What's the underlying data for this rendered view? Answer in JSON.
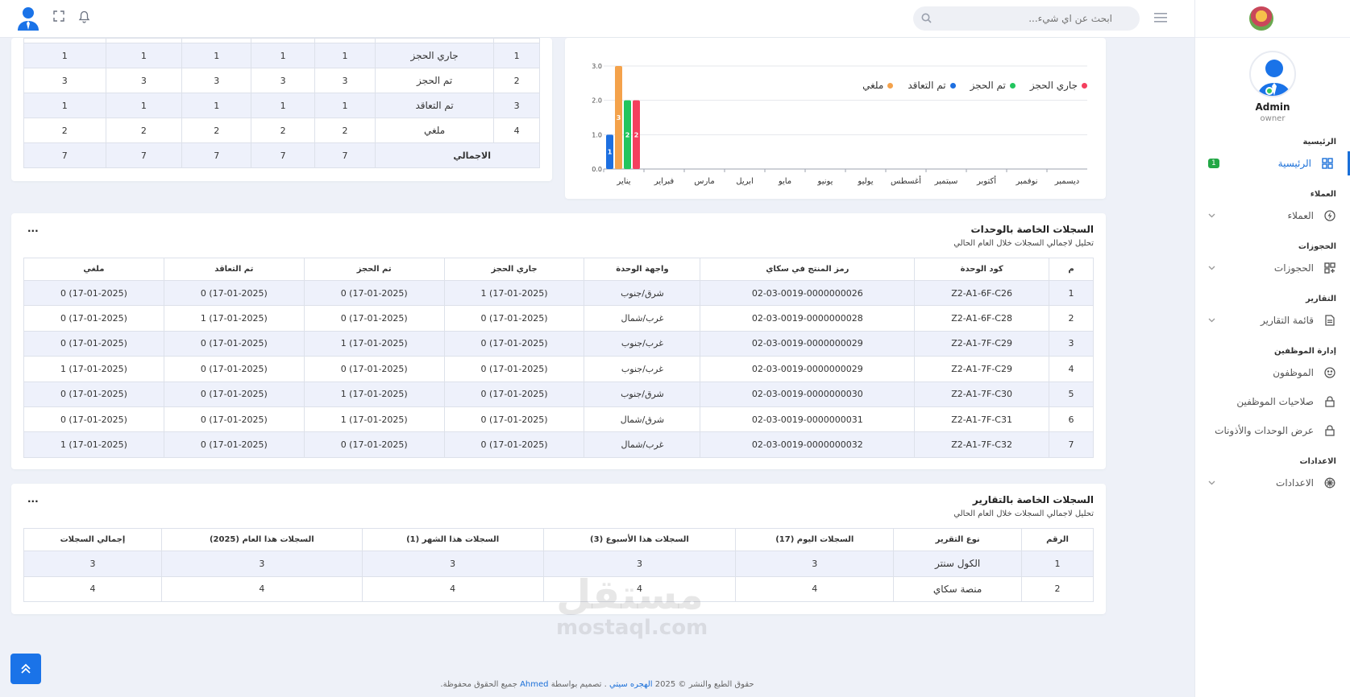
{
  "topbar": {
    "search_placeholder": "ابحث عن اي شيء...",
    "menu_icon": "hamburger-icon",
    "bell_icon": "bell-icon",
    "fullscreen_icon": "fullscreen-icon"
  },
  "sidebar": {
    "profile": {
      "name": "Admin",
      "role": "owner"
    },
    "sections": [
      {
        "title": "الرئيسية",
        "items": [
          {
            "label": "الرئيسية",
            "icon": "grid-icon",
            "badge": "1",
            "active": true
          }
        ]
      },
      {
        "title": "العملاء",
        "items": [
          {
            "label": "العملاء",
            "icon": "bolt-icon",
            "chevron": true
          }
        ]
      },
      {
        "title": "الحجوزات",
        "items": [
          {
            "label": "الحجوزات",
            "icon": "grid-plus-icon",
            "chevron": true
          }
        ]
      },
      {
        "title": "التقارير",
        "items": [
          {
            "label": "قائمة التقارير",
            "icon": "document-icon",
            "chevron": true
          }
        ]
      },
      {
        "title": "إدارة الموظفين",
        "items": [
          {
            "label": "الموظفون",
            "icon": "smile-icon"
          },
          {
            "label": "صلاحيات الموظفين",
            "icon": "lock-icon"
          },
          {
            "label": "عرض الوحدات والأذونات",
            "icon": "lock-icon"
          }
        ]
      },
      {
        "title": "الاعدادات",
        "items": [
          {
            "label": "الاعدادات",
            "icon": "gear-icon",
            "chevron": true
          }
        ]
      }
    ]
  },
  "summary_table": {
    "rows": [
      {
        "num": "1",
        "label": "جاري الحجز",
        "vals": [
          "1",
          "1",
          "1",
          "1",
          "1"
        ]
      },
      {
        "num": "2",
        "label": "تم الحجز",
        "vals": [
          "3",
          "3",
          "3",
          "3",
          "3"
        ]
      },
      {
        "num": "3",
        "label": "تم التعاقد",
        "vals": [
          "1",
          "1",
          "1",
          "1",
          "1"
        ]
      },
      {
        "num": "4",
        "label": "ملغي",
        "vals": [
          "2",
          "2",
          "2",
          "2",
          "2"
        ]
      }
    ],
    "total": {
      "label": "الاجمالي",
      "vals": [
        "7",
        "7",
        "7",
        "7",
        "7"
      ]
    }
  },
  "chart_data": {
    "type": "bar",
    "categories": [
      "يناير",
      "فبراير",
      "مارس",
      "ابريل",
      "مايو",
      "يونيو",
      "يوليو",
      "أغسطس",
      "سبتمبر",
      "أكتوبر",
      "نوفمبر",
      "ديسمبر"
    ],
    "series": [
      {
        "name": "جاري الحجز",
        "color": "#f43f5e",
        "values": [
          2,
          0,
          0,
          0,
          0,
          0,
          0,
          0,
          0,
          0,
          0,
          0
        ]
      },
      {
        "name": "تم الحجز",
        "color": "#22c55e",
        "values": [
          2,
          0,
          0,
          0,
          0,
          0,
          0,
          0,
          0,
          0,
          0,
          0
        ]
      },
      {
        "name": "تم التعاقد",
        "color": "#1d6fe0",
        "values": [
          1,
          0,
          0,
          0,
          0,
          0,
          0,
          0,
          0,
          0,
          0,
          0
        ]
      },
      {
        "name": "ملغي",
        "color": "#f4a24b",
        "values": [
          3,
          0,
          0,
          0,
          0,
          0,
          0,
          0,
          0,
          0,
          0,
          0
        ]
      }
    ],
    "bar_order": [
      "تم التعاقد",
      "ملغي",
      "تم الحجز",
      "جاري الحجز"
    ],
    "yticks": [
      "0.0",
      "1.0",
      "2.0",
      "3.0"
    ],
    "ylim": [
      0,
      3
    ],
    "grid": true,
    "legend_position": "top-right"
  },
  "units_card": {
    "title": "السجلات الخاصة بالوحدات",
    "subtitle": "تحليل لاجمالي السجلات خلال العام الحالي",
    "more": "...",
    "headers": [
      "م",
      "كود الوحدة",
      "رمز المنتج في سكاي",
      "واجهة الوحدة",
      "جاري الحجز",
      "تم الحجز",
      "تم التعاقد",
      "ملغي"
    ],
    "rows": [
      [
        "1",
        "Z2-A1-6F-C26",
        "02-03-0019-0000000026",
        "شرق/جنوب",
        "1 (17-01-2025)",
        "0 (17-01-2025)",
        "0 (17-01-2025)",
        "0 (17-01-2025)"
      ],
      [
        "2",
        "Z2-A1-6F-C28",
        "02-03-0019-0000000028",
        "غرب/شمال",
        "0 (17-01-2025)",
        "0 (17-01-2025)",
        "1 (17-01-2025)",
        "0 (17-01-2025)"
      ],
      [
        "3",
        "Z2-A1-7F-C29",
        "02-03-0019-0000000029",
        "غرب/جنوب",
        "0 (17-01-2025)",
        "1 (17-01-2025)",
        "0 (17-01-2025)",
        "0 (17-01-2025)"
      ],
      [
        "4",
        "Z2-A1-7F-C29",
        "02-03-0019-0000000029",
        "غرب/جنوب",
        "0 (17-01-2025)",
        "0 (17-01-2025)",
        "0 (17-01-2025)",
        "1 (17-01-2025)"
      ],
      [
        "5",
        "Z2-A1-7F-C30",
        "02-03-0019-0000000030",
        "شرق/جنوب",
        "0 (17-01-2025)",
        "1 (17-01-2025)",
        "0 (17-01-2025)",
        "0 (17-01-2025)"
      ],
      [
        "6",
        "Z2-A1-7F-C31",
        "02-03-0019-0000000031",
        "شرق/شمال",
        "0 (17-01-2025)",
        "1 (17-01-2025)",
        "0 (17-01-2025)",
        "0 (17-01-2025)"
      ],
      [
        "7",
        "Z2-A1-7F-C32",
        "02-03-0019-0000000032",
        "غرب/شمال",
        "0 (17-01-2025)",
        "0 (17-01-2025)",
        "0 (17-01-2025)",
        "1 (17-01-2025)"
      ]
    ]
  },
  "reports_card": {
    "title": "السجلات الخاصة بالتقارير",
    "subtitle": "تحليل لاجمالي السجلات خلال العام الحالي",
    "more": "...",
    "headers": [
      "الرقم",
      "نوع التقرير",
      "السجلات اليوم (17)",
      "السجلات هذا الأسبوع (3)",
      "السجلات هذا الشهر (1)",
      "السجلات هذا العام (2025)",
      "إجمالي السجلات"
    ],
    "rows": [
      [
        "1",
        "الكول سنتر",
        "3",
        "3",
        "3",
        "3",
        "3"
      ],
      [
        "2",
        "منصة سكاي",
        "4",
        "4",
        "4",
        "4",
        "4"
      ]
    ]
  },
  "footer": {
    "prefix": "حقوق الطبع والنشر © 2025",
    "brand": "الهجره سيتي",
    "middle": ". تصميم بواسطة",
    "author": "Ahmed",
    "suffix": "جميع الحقوق محفوظة."
  },
  "watermark": {
    "line1": "مستقل",
    "line2": "mostaql.com"
  }
}
